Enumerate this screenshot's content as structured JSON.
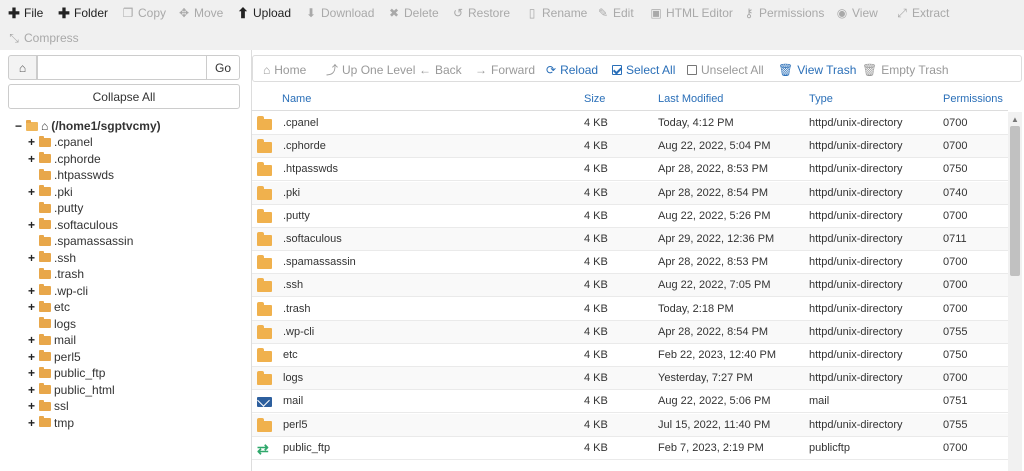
{
  "toolbar": {
    "row1": [
      {
        "icon": "plus-icon",
        "glyph": "✚",
        "label": "File",
        "enabled": true
      },
      {
        "icon": "plus-icon",
        "glyph": "✚",
        "label": "Folder",
        "enabled": true
      },
      {
        "icon": "copy-icon",
        "glyph": "❐",
        "label": "Copy",
        "enabled": false
      },
      {
        "icon": "move-icon",
        "glyph": "✥",
        "label": "Move",
        "enabled": false
      },
      {
        "icon": "upload-icon",
        "glyph": "⬆",
        "label": "Upload",
        "enabled": true
      },
      {
        "icon": "download-icon",
        "glyph": "⬇",
        "label": "Download",
        "enabled": false
      },
      {
        "icon": "delete-icon",
        "glyph": "✖",
        "label": "Delete",
        "enabled": false
      },
      {
        "icon": "restore-icon",
        "glyph": "↺",
        "label": "Restore",
        "enabled": false
      },
      {
        "icon": "rename-icon",
        "glyph": "▯",
        "label": "Rename",
        "enabled": false
      },
      {
        "icon": "edit-icon",
        "glyph": "✎",
        "label": "Edit",
        "enabled": false
      },
      {
        "icon": "html-editor-icon",
        "glyph": "▣",
        "label": "HTML Editor",
        "enabled": false
      },
      {
        "icon": "key-icon",
        "glyph": "⚷",
        "label": "Permissions",
        "enabled": false
      },
      {
        "icon": "eye-icon",
        "glyph": "◉",
        "label": "View",
        "enabled": false
      },
      {
        "icon": "extract-icon",
        "glyph": "⤢",
        "label": "Extract",
        "enabled": false
      }
    ],
    "row2": [
      {
        "icon": "compress-icon",
        "glyph": "⤡",
        "label": "Compress",
        "enabled": false
      }
    ]
  },
  "left": {
    "path_value": "",
    "go_label": "Go",
    "collapse_label": "Collapse All",
    "root_label": "(/home1/sgptvcmy)",
    "tree": [
      {
        "label": ".cpanel",
        "expandable": true
      },
      {
        "label": ".cphorde",
        "expandable": true
      },
      {
        "label": ".htpasswds",
        "expandable": false
      },
      {
        "label": ".pki",
        "expandable": true
      },
      {
        "label": ".putty",
        "expandable": false
      },
      {
        "label": ".softaculous",
        "expandable": true
      },
      {
        "label": ".spamassassin",
        "expandable": false
      },
      {
        "label": ".ssh",
        "expandable": true
      },
      {
        "label": ".trash",
        "expandable": false
      },
      {
        "label": ".wp-cli",
        "expandable": true
      },
      {
        "label": "etc",
        "expandable": true
      },
      {
        "label": "logs",
        "expandable": false
      },
      {
        "label": "mail",
        "expandable": true
      },
      {
        "label": "perl5",
        "expandable": true
      },
      {
        "label": "public_ftp",
        "expandable": true
      },
      {
        "label": "public_html",
        "expandable": true
      },
      {
        "label": "ssl",
        "expandable": true
      },
      {
        "label": "tmp",
        "expandable": true
      }
    ]
  },
  "nav": [
    {
      "icon": "home-icon",
      "glyph": "⌂",
      "label": "Home",
      "state": "disabled"
    },
    {
      "icon": "up-level-icon",
      "glyph": "⤴",
      "label": "Up One Level",
      "state": "disabled"
    },
    {
      "icon": "arrow-left-icon",
      "glyph": "←",
      "label": "Back",
      "state": "disabled"
    },
    {
      "icon": "arrow-right-icon",
      "glyph": "→",
      "label": "Forward",
      "state": "disabled"
    },
    {
      "icon": "reload-icon",
      "glyph": "⟳",
      "label": "Reload",
      "state": "active"
    },
    {
      "icon": "checkbox-checked-icon",
      "glyph": "",
      "label": "Select All",
      "state": "active"
    },
    {
      "icon": "checkbox-empty-icon",
      "glyph": "",
      "label": "Unselect All",
      "state": "disabled"
    },
    {
      "icon": "trash-icon",
      "glyph": "🗑",
      "label": "View Trash",
      "state": "active"
    },
    {
      "icon": "trash-icon",
      "glyph": "🗑",
      "label": "Empty Trash",
      "state": "disabled"
    }
  ],
  "table": {
    "columns": [
      "Name",
      "Size",
      "Last Modified",
      "Type",
      "Permissions"
    ],
    "rows": [
      {
        "icon": "folder",
        "name": ".cpanel",
        "size": "4 KB",
        "modified": "Today, 4:12 PM",
        "type": "httpd/unix-directory",
        "perms": "0700"
      },
      {
        "icon": "folder",
        "name": ".cphorde",
        "size": "4 KB",
        "modified": "Aug 22, 2022, 5:04 PM",
        "type": "httpd/unix-directory",
        "perms": "0700"
      },
      {
        "icon": "folder",
        "name": ".htpasswds",
        "size": "4 KB",
        "modified": "Apr 28, 2022, 8:53 PM",
        "type": "httpd/unix-directory",
        "perms": "0750"
      },
      {
        "icon": "folder",
        "name": ".pki",
        "size": "4 KB",
        "modified": "Apr 28, 2022, 8:54 PM",
        "type": "httpd/unix-directory",
        "perms": "0740"
      },
      {
        "icon": "folder",
        "name": ".putty",
        "size": "4 KB",
        "modified": "Aug 22, 2022, 5:26 PM",
        "type": "httpd/unix-directory",
        "perms": "0700"
      },
      {
        "icon": "folder",
        "name": ".softaculous",
        "size": "4 KB",
        "modified": "Apr 29, 2022, 12:36 PM",
        "type": "httpd/unix-directory",
        "perms": "0711"
      },
      {
        "icon": "folder",
        "name": ".spamassassin",
        "size": "4 KB",
        "modified": "Apr 28, 2022, 8:53 PM",
        "type": "httpd/unix-directory",
        "perms": "0700"
      },
      {
        "icon": "folder",
        "name": ".ssh",
        "size": "4 KB",
        "modified": "Aug 22, 2022, 7:05 PM",
        "type": "httpd/unix-directory",
        "perms": "0700"
      },
      {
        "icon": "folder",
        "name": ".trash",
        "size": "4 KB",
        "modified": "Today, 2:18 PM",
        "type": "httpd/unix-directory",
        "perms": "0700"
      },
      {
        "icon": "folder",
        "name": ".wp-cli",
        "size": "4 KB",
        "modified": "Apr 28, 2022, 8:54 PM",
        "type": "httpd/unix-directory",
        "perms": "0755"
      },
      {
        "icon": "folder",
        "name": "etc",
        "size": "4 KB",
        "modified": "Feb 22, 2023, 12:40 PM",
        "type": "httpd/unix-directory",
        "perms": "0750"
      },
      {
        "icon": "folder",
        "name": "logs",
        "size": "4 KB",
        "modified": "Yesterday, 7:27 PM",
        "type": "httpd/unix-directory",
        "perms": "0700"
      },
      {
        "icon": "mail",
        "name": "mail",
        "size": "4 KB",
        "modified": "Aug 22, 2022, 5:06 PM",
        "type": "mail",
        "perms": "0751"
      },
      {
        "icon": "folder",
        "name": "perl5",
        "size": "4 KB",
        "modified": "Jul 15, 2022, 11:40 PM",
        "type": "httpd/unix-directory",
        "perms": "0755"
      },
      {
        "icon": "transfer",
        "name": "public_ftp",
        "size": "4 KB",
        "modified": "Feb 7, 2023, 2:19 PM",
        "type": "publicftp",
        "perms": "0700"
      }
    ]
  }
}
